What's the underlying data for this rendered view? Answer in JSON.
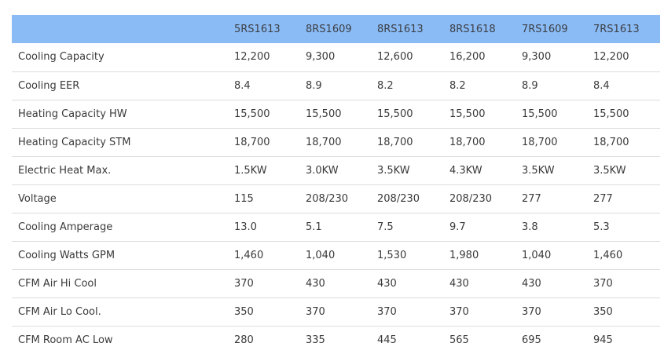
{
  "table": {
    "headers": [
      "",
      "5RS1613",
      "8RS1609",
      "8RS1613",
      "8RS1618",
      "7RS1609",
      "7RS1613"
    ],
    "rows": [
      {
        "label": "Cooling Capacity",
        "values": [
          "12,200",
          "9,300",
          "12,600",
          "16,200",
          "9,300",
          "12,200"
        ]
      },
      {
        "label": "Cooling EER",
        "values": [
          "8.4",
          "8.9",
          "8.2",
          "8.2",
          "8.9",
          "8.4"
        ]
      },
      {
        "label": "Heating Capacity HW",
        "values": [
          "15,500",
          "15,500",
          "15,500",
          "15,500",
          "15,500",
          "15,500"
        ]
      },
      {
        "label": "Heating Capacity STM",
        "values": [
          "18,700",
          "18,700",
          "18,700",
          "18,700",
          "18,700",
          "18,700"
        ]
      },
      {
        "label": "Electric Heat Max.",
        "values": [
          "1.5KW",
          "3.0KW",
          "3.5KW",
          "4.3KW",
          "3.5KW",
          "3.5KW"
        ]
      },
      {
        "label": "Voltage",
        "values": [
          "115",
          "208/230",
          "208/230",
          "208/230",
          "277",
          "277"
        ]
      },
      {
        "label": "Cooling Amperage",
        "values": [
          "13.0",
          "5.1",
          "7.5",
          "9.7",
          "3.8",
          "5.3"
        ]
      },
      {
        "label": "Cooling Watts GPM",
        "values": [
          "1,460",
          "1,040",
          "1,530",
          "1,980",
          "1,040",
          "1,460"
        ]
      },
      {
        "label": "CFM Air Hi Cool",
        "values": [
          "370",
          "430",
          "430",
          "430",
          "430",
          "370"
        ]
      },
      {
        "label": "CFM Air Lo Cool.",
        "values": [
          "350",
          "370",
          "370",
          "370",
          "370",
          "350"
        ]
      },
      {
        "label": "CFM Room AC Low",
        "values": [
          "280",
          "335",
          "445",
          "565",
          "695",
          "945"
        ]
      }
    ]
  },
  "colors": {
    "header_bg": "#8bbbf5",
    "row_divider": "#dddddd",
    "text": "#3a3a3a"
  }
}
